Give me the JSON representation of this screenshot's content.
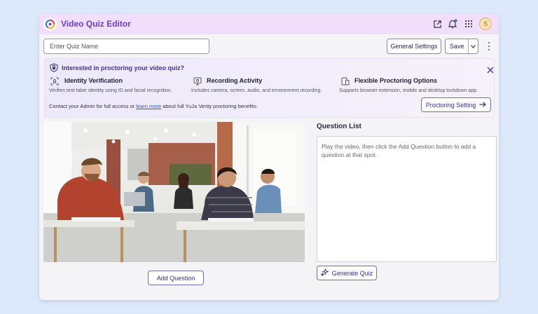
{
  "app": {
    "title": "Video Quiz Editor",
    "avatar_initial": "S"
  },
  "colors": {
    "accent": "#6b3fc4",
    "titlebar_bg": "#f1defa",
    "page_bg": "#dde9fb",
    "link": "#2a5ac8"
  },
  "toolbar": {
    "quiz_name_placeholder": "Enter Quiz Name",
    "general_settings_label": "General Settings",
    "save_label": "Save"
  },
  "banner": {
    "title": "Interested in proctoring your video quiz?",
    "features": [
      {
        "icon": "face-scan-icon",
        "title": "Identity Verification",
        "desc": "Verifies test-taker identity using ID and facial recognition."
      },
      {
        "icon": "monitor-record-icon",
        "title": "Recording Activity",
        "desc": "Includes camera, screen, audio, and environment recording."
      },
      {
        "icon": "devices-icon",
        "title": "Flexible Proctoring Options",
        "desc": "Supports browser extension, mobile and desktop lockdown app."
      }
    ],
    "footer_prefix": "Contact your Admin for full access or ",
    "footer_link": "learn more",
    "footer_suffix": " about full YuJa Verity proctoring benefits.",
    "proctoring_button": "Proctoring Setting"
  },
  "video": {
    "add_question_label": "Add Question"
  },
  "question_list": {
    "title": "Question List",
    "empty_text": "Play the video, then click the Add Question button to add a question at that spot.",
    "generate_label": "Generate Quiz"
  }
}
